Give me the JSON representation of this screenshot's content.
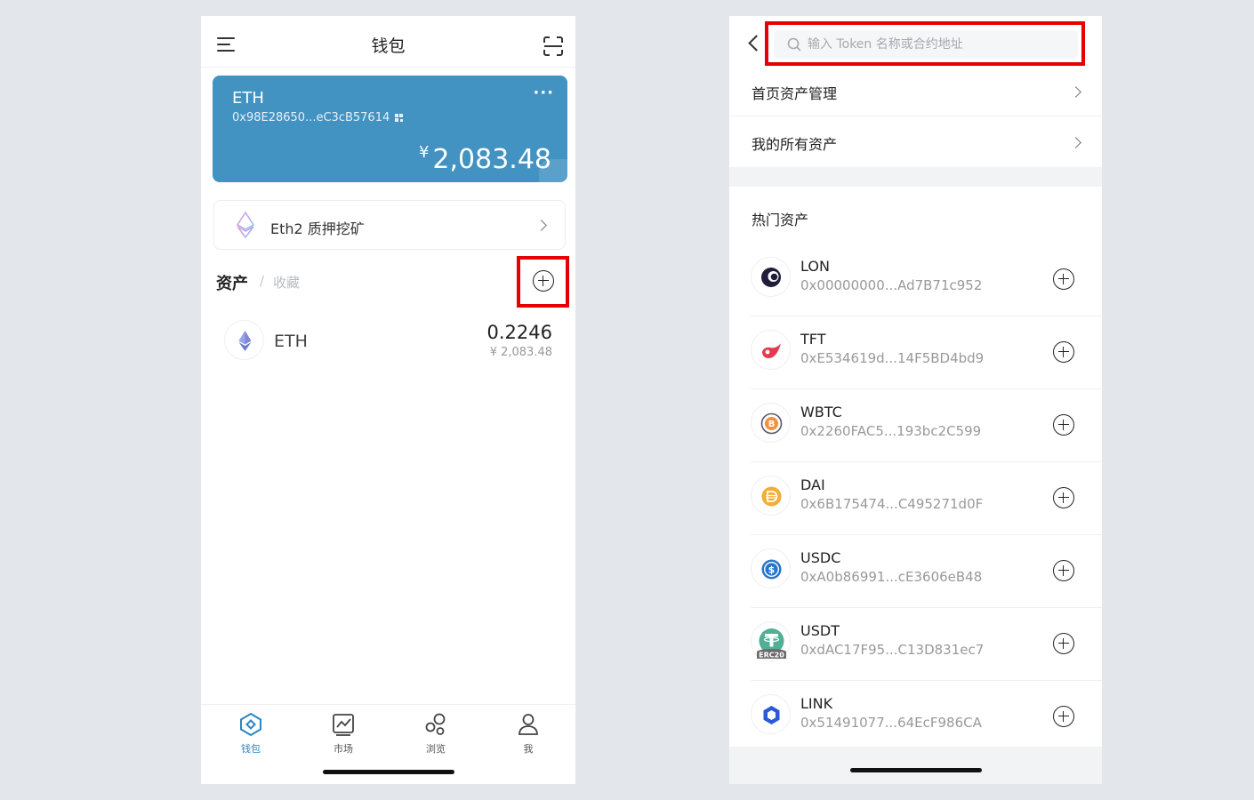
{
  "left": {
    "header": {
      "title": "钱包"
    },
    "wallet_card": {
      "name": "ETH",
      "address": "0x98E28650...eC3cB57614",
      "currency_symbol": "¥",
      "balance": "2,083.48",
      "color": "#4292c2"
    },
    "staking": {
      "label": "Eth2 质押挖矿"
    },
    "assets_tabs": {
      "assets": "资产",
      "separator": "/",
      "favorites": "收藏"
    },
    "assets": [
      {
        "symbol": "ETH",
        "amount": "0.2246",
        "fiat": "¥ 2,083.48",
        "icon": "ethereum-icon"
      }
    ],
    "tabbar": [
      {
        "label": "钱包",
        "icon": "wallet-icon",
        "active": true
      },
      {
        "label": "市场",
        "icon": "market-chart-icon",
        "active": false
      },
      {
        "label": "浏览",
        "icon": "browse-bubbles-icon",
        "active": false
      },
      {
        "label": "我",
        "icon": "person-icon",
        "active": false
      }
    ]
  },
  "right": {
    "search": {
      "placeholder": "输入 Token 名称或合约地址",
      "value": ""
    },
    "menu": [
      {
        "label": "首页资产管理"
      },
      {
        "label": "我的所有资产"
      }
    ],
    "hot_title": "热门资产",
    "tokens": [
      {
        "symbol": "LON",
        "address": "0x00000000...Ad7B71c952",
        "icon": "lon-icon"
      },
      {
        "symbol": "TFT",
        "address": "0xE534619d...14F5BD4bd9",
        "icon": "tft-icon"
      },
      {
        "symbol": "WBTC",
        "address": "0x2260FAC5...193bc2C599",
        "icon": "wbtc-icon"
      },
      {
        "symbol": "DAI",
        "address": "0x6B175474...C495271d0F",
        "icon": "dai-icon"
      },
      {
        "symbol": "USDC",
        "address": "0xA0b86991...cE3606eB48",
        "icon": "usdc-icon"
      },
      {
        "symbol": "USDT",
        "address": "0xdAC17F95...C13D831ec7",
        "icon": "usdt-icon",
        "badge": "ERC20"
      },
      {
        "symbol": "LINK",
        "address": "0x51491077...64EcF986CA",
        "icon": "chainlink-icon"
      }
    ]
  },
  "highlight_color": "#e60000"
}
